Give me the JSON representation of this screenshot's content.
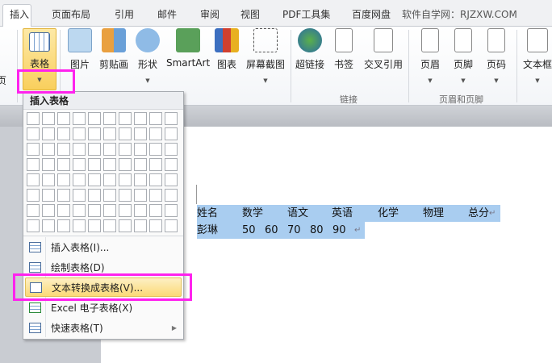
{
  "tabs": [
    "插入",
    "页面布局",
    "引用",
    "邮件",
    "审阅",
    "视图",
    "PDF工具集",
    "百度网盘"
  ],
  "watermark": "软件自学网：RJZXW.COM",
  "ribbon": {
    "left_partial": "页",
    "buttons": [
      "表格",
      "图片",
      "剪贴画",
      "形状",
      "SmartArt",
      "图表",
      "屏幕截图",
      "超链接",
      "书签",
      "交叉引用",
      "页眉",
      "页脚",
      "页码",
      "文本框"
    ],
    "groups": [
      "链接",
      "页眉和页脚"
    ]
  },
  "menu": {
    "title": "插入表格",
    "items": [
      "插入表格(I)...",
      "绘制表格(D)",
      "文本转换成表格(V)...",
      "Excel 电子表格(X)",
      "快速表格(T)"
    ]
  },
  "document": {
    "row1": [
      "姓名",
      "数学",
      "语文",
      "英语",
      "化学",
      "物理",
      "总分"
    ],
    "row2": [
      "彭琳",
      "50",
      "60",
      "70",
      "80",
      "90"
    ],
    "para_mark": "↵"
  },
  "colors": {
    "highlight": "#ff22ee",
    "selection": "#a9cdf0"
  }
}
